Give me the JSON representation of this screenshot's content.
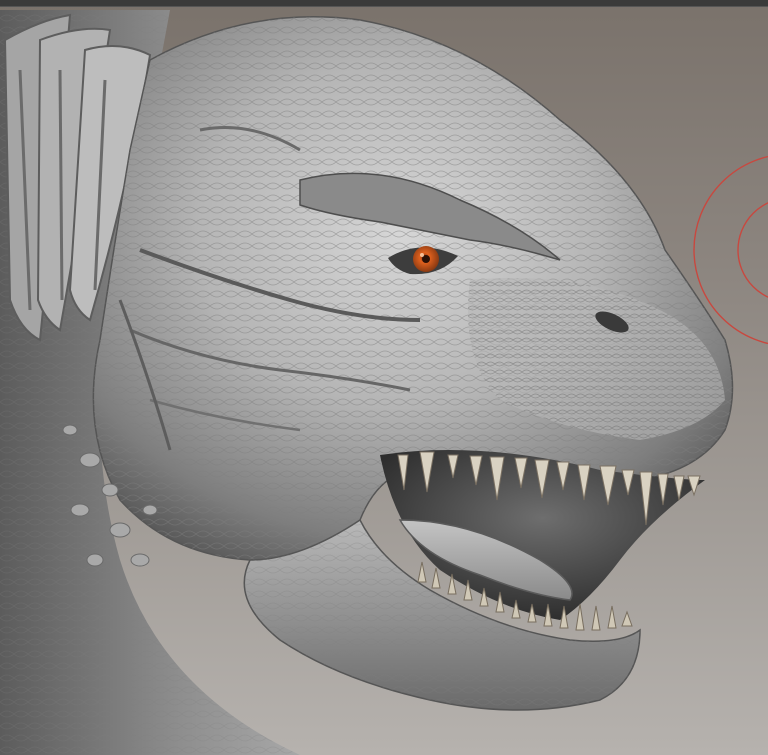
{
  "scene": {
    "subject": "sculpted-creature-head",
    "eye_color": "#e0611e",
    "background_top": "#7a726b",
    "background_bottom": "#b6b2ae",
    "skin_light": "#c9c9c9",
    "skin_mid": "#9a9a9a",
    "skin_dark": "#4d4d4d",
    "tooth_color": "#d9d2c2",
    "cursor_color": "#c8483f"
  },
  "ui": {
    "top_bar_color": "#3a3a3a"
  }
}
